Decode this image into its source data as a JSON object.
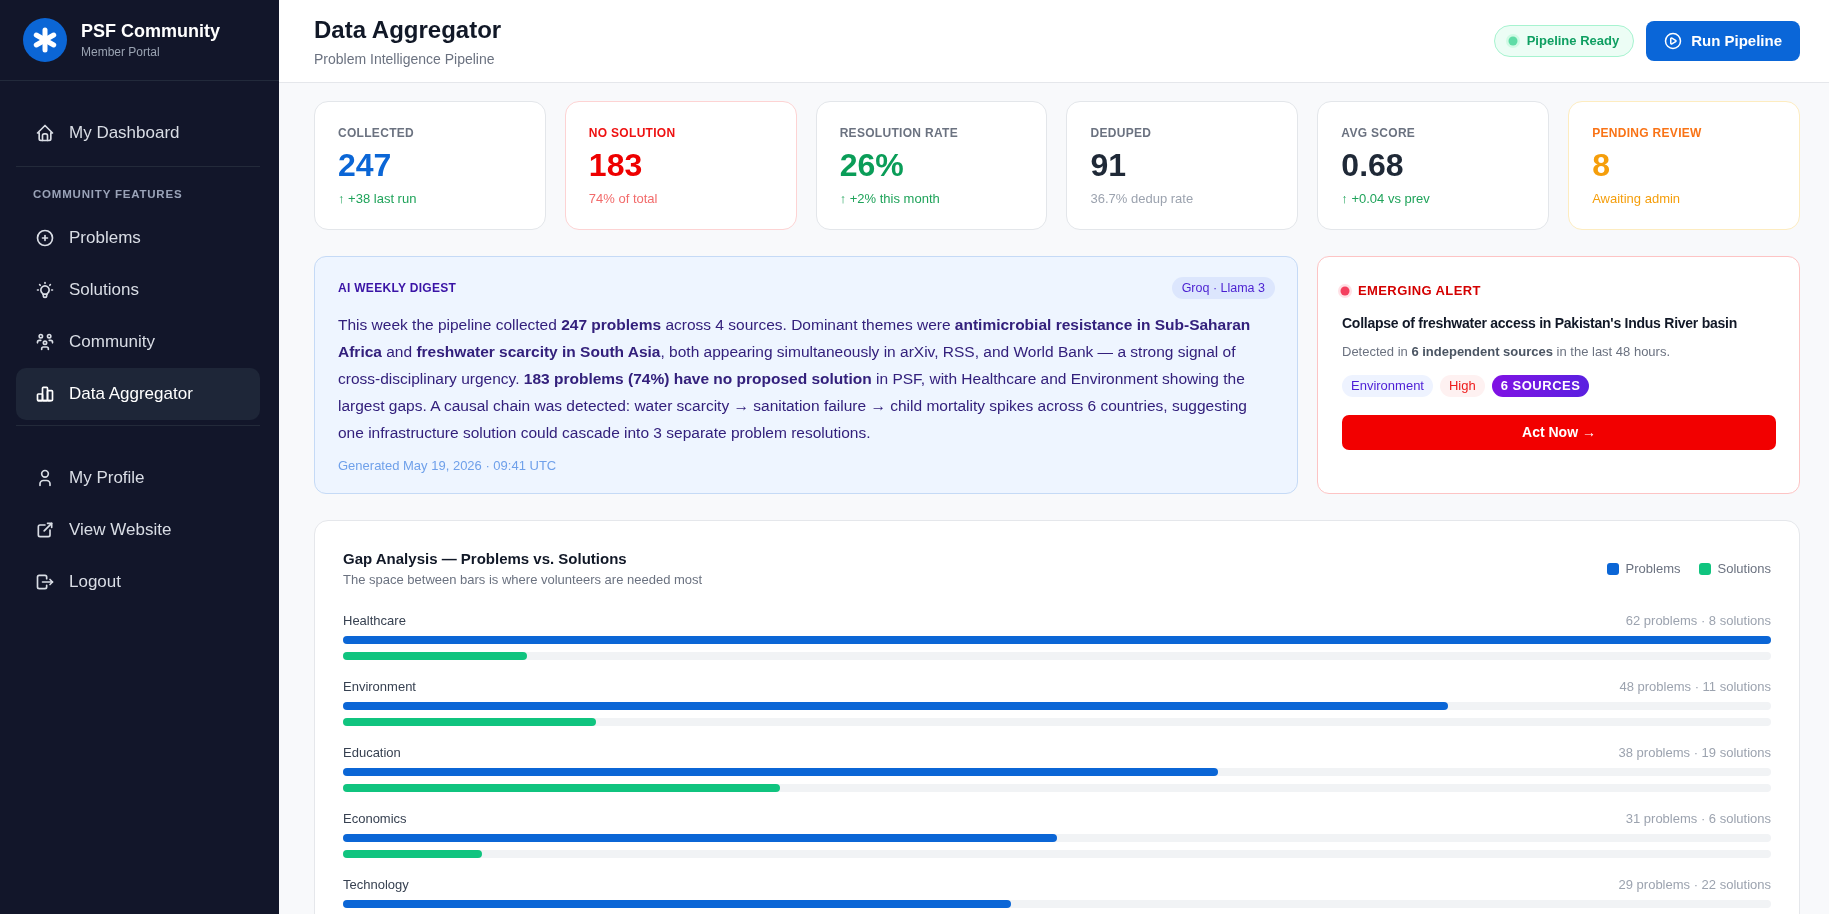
{
  "sidebar": {
    "brand": {
      "name": "PSF Community",
      "subtitle": "Member Portal"
    },
    "sections": [
      {
        "items": [
          {
            "label": "My Dashboard",
            "selected": false
          }
        ]
      },
      {
        "heading": "COMMUNITY FEATURES",
        "items": [
          {
            "label": "Problems",
            "selected": false
          },
          {
            "label": "Solutions",
            "selected": false
          },
          {
            "label": "Community",
            "selected": false
          },
          {
            "label": "Data Aggregator",
            "selected": true
          }
        ]
      },
      {
        "items": [
          {
            "label": "My Profile",
            "selected": false
          },
          {
            "label": "View Website",
            "selected": false
          },
          {
            "label": "Logout",
            "selected": false
          }
        ]
      }
    ]
  },
  "header": {
    "title": "Data Aggregator",
    "subtitle": "Problem Intelligence Pipeline",
    "status": "Pipeline Ready",
    "action": "Run Pipeline"
  },
  "stats": [
    {
      "label": "COLLECTED",
      "value": "247",
      "note": "↑ +38 last run",
      "kind": "total",
      "rising": true
    },
    {
      "label": "NO SOLUTION",
      "value": "183",
      "note": "74% of total",
      "kind": "danger",
      "rising": false
    },
    {
      "label": "RESOLUTION RATE",
      "value": "26%",
      "note": "↑ +2% this month",
      "kind": "success",
      "rising": true
    },
    {
      "label": "DEDUPED",
      "value": "91",
      "note": "36.7% dedup rate",
      "kind": "plain",
      "rising": false
    },
    {
      "label": "AVG SCORE",
      "value": "0.68",
      "note": "↑ +0.04 vs prev",
      "kind": "plain",
      "rising": true
    },
    {
      "label": "PENDING REVIEW",
      "value": "8",
      "note": "Awaiting admin",
      "kind": "warning",
      "rising": false
    }
  ],
  "digest": {
    "heading": "AI WEEKLY DIGEST",
    "badge": "Groq · Llama 3",
    "body": "This week the pipeline collected **247 problems** across 4 sources. Dominant themes were **antimicrobial resistance in Sub-Saharan Africa** and **freshwater scarcity in South Asia**, both appearing simultaneously in arXiv, RSS, and World Bank — a strong signal of cross-disciplinary urgency. **183 problems (74%) have no proposed solution** in PSF, with Healthcare and Environment showing the largest gaps. A causal chain was detected: water scarcity → sanitation failure → child mortality spikes across 6 countries, suggesting one infrastructure solution could cascade into 3 separate problem resolutions.",
    "generated": "Generated May 19, 2026 · 09:41 UTC"
  },
  "alert": {
    "heading": "EMERGING ALERT",
    "title": "Collapse of freshwater access in Pakistan's Indus River basin",
    "details": "Detected in **6 independent sources** in the last 48 hours.",
    "tags": [
      {
        "label": "Environment",
        "kind": "category"
      },
      {
        "label": "High",
        "kind": "severity"
      },
      {
        "label": "6 SOURCES",
        "kind": "count"
      }
    ],
    "action": "Act Now →"
  },
  "gap_analysis": {
    "title": "Gap Analysis — Problems vs. Solutions",
    "subtitle": "The space between bars is where volunteers are needed most",
    "legend": [
      {
        "label": "Problems",
        "color": "#0b66d6"
      },
      {
        "label": "Solutions",
        "color": "#10c47f"
      }
    ],
    "rows": [
      {
        "label": "Healthcare",
        "counts": "62 problems · 8 solutions",
        "bars": [
          {
            "level": 1
          },
          {
            "level": 0.129
          }
        ]
      },
      {
        "label": "Environment",
        "counts": "48 problems · 11 solutions",
        "bars": [
          {
            "level": 0.774
          },
          {
            "level": 0.177
          }
        ]
      },
      {
        "label": "Education",
        "counts": "38 problems · 19 solutions",
        "bars": [
          {
            "level": 0.613
          },
          {
            "level": 0.306
          }
        ]
      },
      {
        "label": "Economics",
        "counts": "31 problems · 6 solutions",
        "bars": [
          {
            "level": 0.5
          },
          {
            "level": 0.097
          }
        ]
      },
      {
        "label": "Technology",
        "counts": "29 problems · 22 solutions",
        "bars": [
          {
            "level": 0.468
          }
        ]
      }
    ]
  }
}
